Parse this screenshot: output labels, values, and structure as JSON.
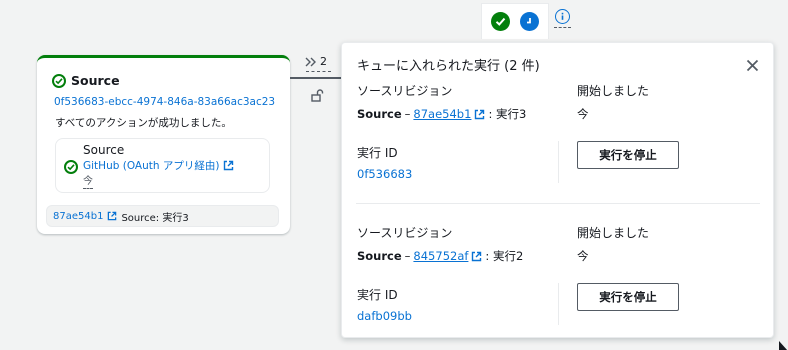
{
  "toolbar": {
    "success_icon": "check-icon",
    "pending_icon": "clock-icon",
    "info_icon": "info-icon"
  },
  "stage": {
    "title": "Source",
    "execution_id": "0f536683-ebcc-4974-846a-83a66ac3ac23",
    "status_text": "すべてのアクションが成功しました。",
    "action": {
      "name": "Source",
      "provider": "GitHub (OAuth アプリ経由)",
      "time": "今"
    },
    "revision": {
      "commit": "87ae54b1",
      "label": "Source: 実行3"
    }
  },
  "connector": {
    "queue_count": "2"
  },
  "popover": {
    "title": "キューに入れられた実行 (2 件)",
    "executions": [
      {
        "revision_label": "ソースリビジョン",
        "source_name": "Source",
        "dash": " – ",
        "commit": "87ae54b1",
        "suffix": ": 実行3",
        "started_label": "開始しました",
        "started_value": "今",
        "exec_id_label": "実行 ID",
        "exec_id": "0f536683",
        "stop_label": "実行を停止"
      },
      {
        "revision_label": "ソースリビジョン",
        "source_name": "Source",
        "dash": " – ",
        "commit": "845752af",
        "suffix": ": 実行2",
        "started_label": "開始しました",
        "started_value": "今",
        "exec_id_label": "実行 ID",
        "exec_id": "dafb09bb",
        "stop_label": "実行を停止"
      }
    ]
  },
  "colors": {
    "success": "#037f0c",
    "link": "#0972d3",
    "border": "#e9ebed",
    "background": "#f2f3f3"
  }
}
